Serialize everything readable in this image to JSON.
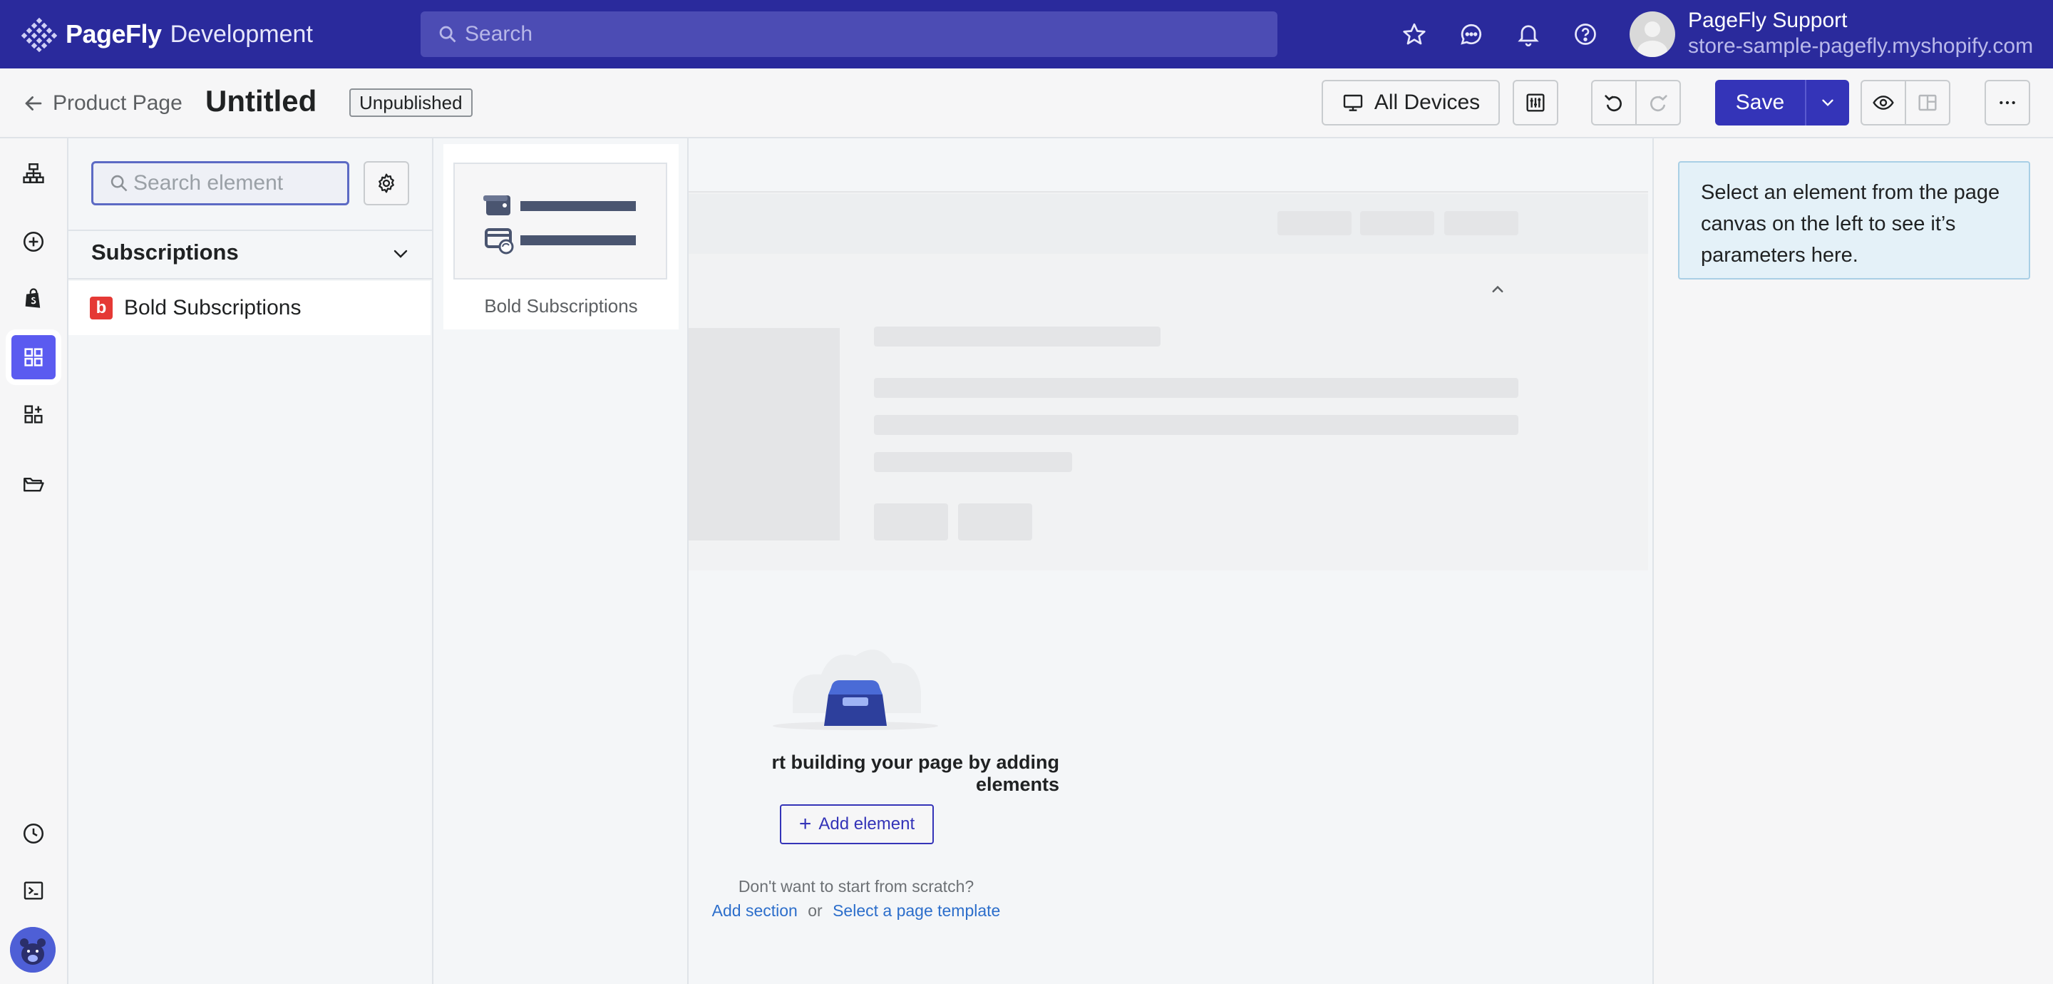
{
  "app": {
    "brand_name": "PageFly",
    "environment": "Development"
  },
  "topbar": {
    "search_placeholder": "Search",
    "user_name": "PageFly Support",
    "store_domain": "store-sample-pagefly.myshopify.com"
  },
  "editor_bar": {
    "back_label": "Product Page",
    "page_title": "Untitled",
    "status_badge": "Unpublished",
    "devices_label": "All Devices",
    "save_label": "Save"
  },
  "element_panel": {
    "search_placeholder": "Search element",
    "search_value": "",
    "category_title": "Subscriptions",
    "items": [
      {
        "label": "Bold Subscriptions",
        "logo_letter": "b"
      }
    ]
  },
  "preview": {
    "label": "Bold Subscriptions"
  },
  "canvas": {
    "empty_title": "rt building your page by adding elements",
    "add_element_label": "Add element",
    "scratch_text": "Don't want to start from scratch?",
    "add_section_label": "Add section",
    "or_label": "or",
    "template_label": "Select a page template"
  },
  "inspector": {
    "empty_message": "Select an element from the page canvas on the left to see it’s parameters here."
  },
  "colors": {
    "topbar_bg": "#2a2a9c",
    "primary": "#3434b8",
    "rail_active": "#5b5bf0",
    "bold_logo": "#e53935",
    "info_bg": "#e4f1f8"
  },
  "icons": {
    "brand": "pagefly-logo-icon",
    "search": "search-icon",
    "favorite": "star-icon",
    "chat": "chat-icon",
    "notifications": "bell-icon",
    "help": "help-icon",
    "back": "arrow-left-icon",
    "desktop": "desktop-icon",
    "settings": "gear-icon",
    "undo": "undo-icon",
    "redo": "redo-icon",
    "preview": "eye-icon",
    "more": "more-horizontal-icon"
  }
}
